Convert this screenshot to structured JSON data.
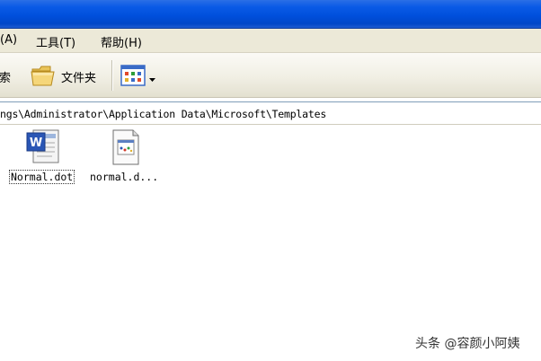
{
  "menubar": {
    "items": [
      {
        "label": "(A)"
      },
      {
        "label": "工具(T)"
      },
      {
        "label": "帮助(H)"
      }
    ]
  },
  "toolbar": {
    "search_label": "搜索",
    "folders_label": "文件夹",
    "icons": [
      "folder-icon",
      "view-icon",
      "dropdown-arrow-icon"
    ]
  },
  "address": {
    "path": "ngs\\Administrator\\Application Data\\Microsoft\\Templates"
  },
  "files": [
    {
      "name": "Normal.dot",
      "icon": "word-doc-icon",
      "selected": true
    },
    {
      "name": "normal.d...",
      "icon": "template-doc-icon",
      "selected": false
    }
  ],
  "watermark": "头条 @容颜小阿姨",
  "colors": {
    "titlebar": "#0a5ae6",
    "menubar": "#ece9d8",
    "address_border": "#7f9db9"
  }
}
